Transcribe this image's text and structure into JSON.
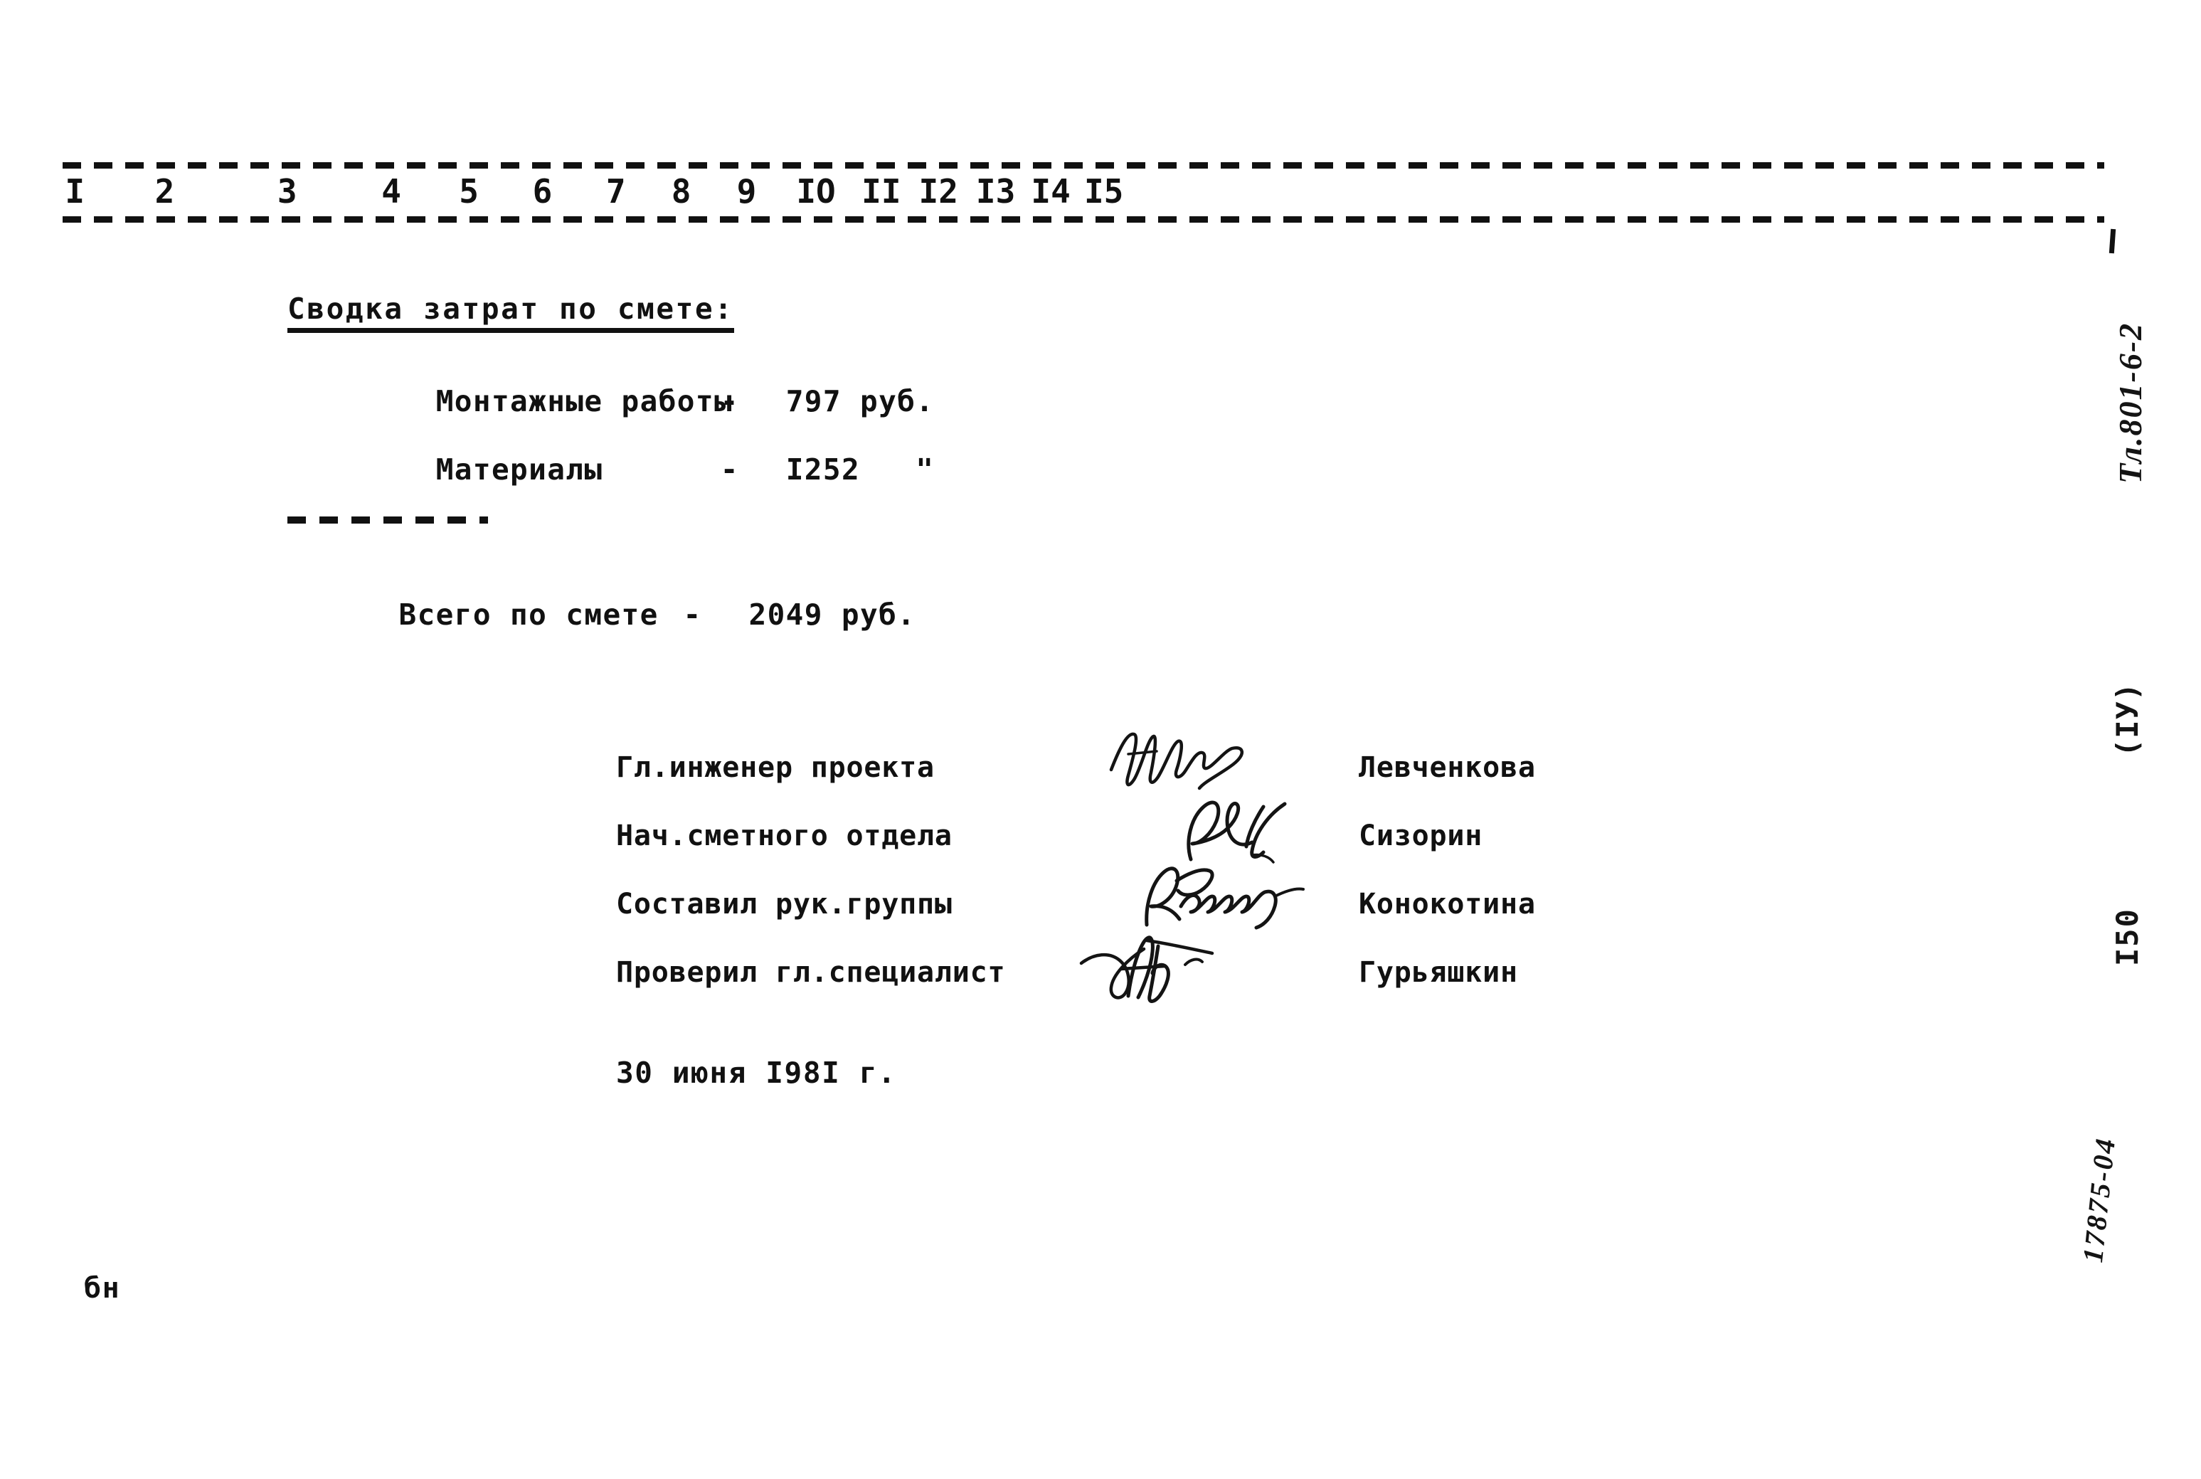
{
  "document": {
    "type": "scanned-typewritten-estimate-summary",
    "language": "ru"
  },
  "ruler": {
    "ticks": [
      "I",
      "2",
      "3",
      "4",
      "5",
      "6",
      "7",
      "8",
      "9",
      "IO",
      "II",
      "I2",
      "I3",
      "I4",
      "I5"
    ],
    "positions_pct": [
      0,
      4.5,
      10.5,
      15.6,
      19.4,
      23.0,
      26.6,
      29.8,
      33.0,
      36.2,
      39.4,
      42.2,
      45.0,
      47.7,
      50.3
    ]
  },
  "body": {
    "heading": "Сводка затрат по смете:",
    "rows": [
      {
        "label": "Монтажные работы",
        "dash": "-",
        "value": "797 руб."
      },
      {
        "label": "Материалы",
        "dash": "-",
        "value": "I252   \""
      }
    ],
    "total": {
      "label": "Всего по смете",
      "dash": "-",
      "value": "2049 руб."
    }
  },
  "signatures": [
    {
      "role": "Гл.инженер проекта",
      "name": "Левченкова"
    },
    {
      "role": "Нач.сметного отдела",
      "name": "Сизорин"
    },
    {
      "role": "Составил рук.группы",
      "name": "Конокотина"
    },
    {
      "role": "Проверил гл.специалист",
      "name": "Гурьяшкин"
    }
  ],
  "date_line": "30 июня I98I г.",
  "margin": {
    "code": "Тл.801-6-2",
    "part": "(ІУ)",
    "page": "I50",
    "archive": "17875-04"
  },
  "corner_mark": "бн",
  "colors": {
    "paper": "#ffffff",
    "ink": "#111111",
    "handwriting_ink": "#141414"
  }
}
